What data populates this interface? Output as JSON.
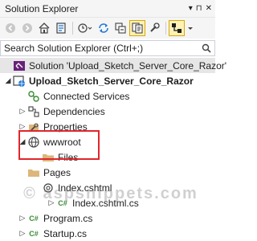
{
  "window": {
    "title": "Solution Explorer",
    "controls": [
      "▾",
      "⊓",
      "✕"
    ]
  },
  "search": {
    "placeholder": "Search Solution Explorer (Ctrl+;)"
  },
  "tree": {
    "solution": "Solution 'Upload_Sketch_Server_Core_Razor'",
    "project": "Upload_Sketch_Server_Core_Razor",
    "connected_services": "Connected Services",
    "dependencies": "Dependencies",
    "properties": "Properties",
    "wwwroot": "wwwroot",
    "files": "Files",
    "pages": "Pages",
    "index_cshtml": "Index.cshtml",
    "index_cshtml_cs": "Index.cshtml.cs",
    "program_cs": "Program.cs",
    "startup_cs": "Startup.cs"
  },
  "watermark": "© aspsnippets.com",
  "colors": {
    "highlight": "#e0262c",
    "folder": "#dcb67a",
    "csharp": "#388a34",
    "selected_button": "#fff1b8"
  }
}
